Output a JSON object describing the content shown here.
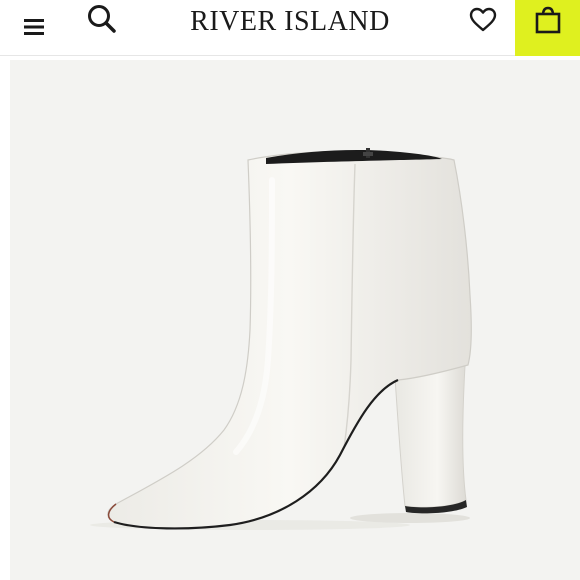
{
  "header": {
    "brand": "RIVER ISLAND",
    "accent_color": "#dff01f",
    "icons": [
      "hamburger-menu-icon",
      "search-icon",
      "heart-icon",
      "shopping-bag-icon"
    ]
  },
  "product": {
    "image": "white-ankle-boot",
    "image_background": "#f3f3f1"
  }
}
